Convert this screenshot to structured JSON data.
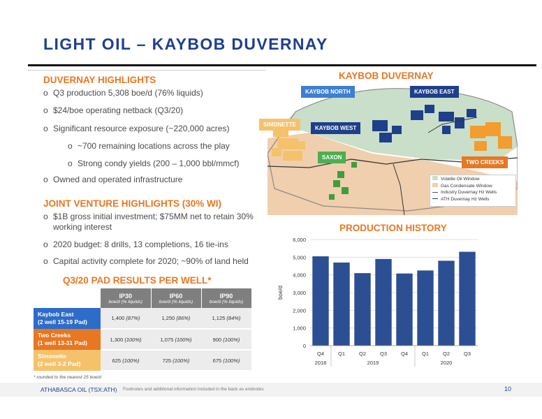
{
  "title": "LIGHT OIL – KAYBOB DUVERNAY",
  "highlights": {
    "heading": "DUVERNAY HIGHLIGHTS",
    "bullets": [
      "Q3 production 5,308 boe/d (76% liquids)",
      "$24/boe operating netback (Q3/20)",
      "Significant resource exposure (~220,000 acres)",
      "~700 remaining locations across the play",
      "Strong condy yields (200 – 1,000 bbl/mmcf)",
      "Owned and operated infrastructure"
    ]
  },
  "jv": {
    "heading": "JOINT VENTURE HIGHLIGHTS (30% WI)",
    "bullet1_line1": "$1B gross initial investment; $75MM net to retain 30%",
    "bullet1_line2": "working interest",
    "bullets": [
      "2020 budget: 8 drills, 13 completions, 16 tie-ins",
      "Capital activity complete for 2020; ~90% of land held"
    ]
  },
  "pad_results": {
    "heading": "Q3/20 PAD RESULTS PER WELL*",
    "headers": [
      {
        "label": "IP30",
        "sub": "boe/d (% liquids)"
      },
      {
        "label": "IP60",
        "sub": "boe/d (% liquids)"
      },
      {
        "label": "IP90",
        "sub": "boe/d (% liquids)"
      }
    ],
    "rows": [
      {
        "name1": "Kaybob East",
        "name2": "(2 well 15-19 Pad)",
        "color": "#2e6cc9",
        "v": [
          "1,400",
          "1,250",
          "1,125"
        ],
        "p": [
          "(87%)",
          "(86%)",
          "(84%)"
        ]
      },
      {
        "name1": "Two Creeks",
        "name2": "(1 well 13-31 Pad)",
        "color": "#e87722",
        "v": [
          "1,300",
          "1,075",
          "900"
        ],
        "p": [
          "(100%)",
          "(100%)",
          "(100%)"
        ]
      },
      {
        "name1": "Simonette",
        "name2": "(2 well 3-2 Pad)",
        "color": "#f5c26b",
        "v": [
          "625",
          "725",
          "675"
        ],
        "p": [
          "(100%)",
          "(100%)",
          "(100%)"
        ]
      }
    ],
    "footnote": "* rounded to the nearest 25 boe/d"
  },
  "map": {
    "heading": "KAYBOB DUVERNAY",
    "labels": {
      "kaybob_north": "KAYBOB NORTH",
      "kaybob_east": "KAYBOB EAST",
      "simonette": "SIMONETTE",
      "kaybob_west": "KAYBOB WEST",
      "saxon": "SAXON",
      "two_creeks": "TWO CREEKS"
    },
    "legend": [
      "Volatile Oil Window",
      "Gas Condensate Window",
      "Industry Duvernay Hz Wells",
      "ATH Duvernay Hz Wells"
    ],
    "colors": {
      "volatile": "#c9dfc9",
      "condensate": "#f0cfae",
      "kaybob_north": "#3d7fd1",
      "kaybob_east": "#1e3f8a",
      "simonette": "#f5c26b",
      "kaybob_west": "#1e3f8a",
      "saxon": "#4caf50",
      "two_creeks": "#e87722"
    }
  },
  "chart_data": {
    "type": "bar",
    "title": "PRODUCTION HISTORY",
    "ylabel": "boe/d",
    "ylim": [
      0,
      6000
    ],
    "yticks": [
      "0",
      "1,000",
      "2,000",
      "3,000",
      "4,000",
      "5,000",
      "6,000"
    ],
    "categories": [
      "Q4",
      "Q1",
      "Q2",
      "Q3",
      "Q4",
      "Q1",
      "Q2",
      "Q3"
    ],
    "values": [
      5050,
      4700,
      4100,
      4900,
      4080,
      4250,
      4800,
      5308
    ],
    "year_labels": [
      "2018",
      "2019",
      "2020"
    ],
    "bar_color": "#2c4f94",
    "grid": true
  },
  "footer": {
    "company": "ATHABASCA OIL (TSX:ATH)",
    "note": "Footnotes and additional information included in the back as endnotes",
    "page": "10"
  }
}
